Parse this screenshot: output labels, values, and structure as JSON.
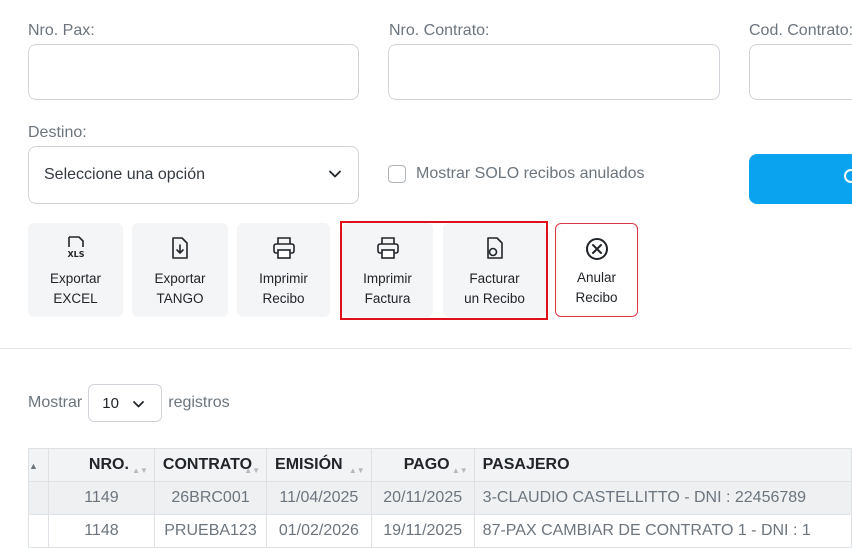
{
  "filters": {
    "nro_pax_label": "Nro. Pax:",
    "nro_contrato_label": "Nro. Contrato:",
    "cod_contrato_label": "Cod. Contrato:",
    "destino_label": "Destino:",
    "destino_value": "Seleccione una opción",
    "solo_anulados_label": "Mostrar SOLO recibos anulados"
  },
  "toolbar": [
    {
      "label_1": "Exportar",
      "label_2": "EXCEL",
      "icon": "xls-icon"
    },
    {
      "label_1": "Exportar",
      "label_2": "TANGO",
      "icon": "file-download-icon"
    },
    {
      "label_1": "Imprimir",
      "label_2": "Recibo",
      "icon": "printer-icon"
    },
    {
      "label_1": "Imprimir",
      "label_2": "Factura",
      "icon": "printer-icon"
    },
    {
      "label_1": "Facturar",
      "label_2": "un Recibo",
      "icon": "file-invoice-icon"
    },
    {
      "label_1": "Anular",
      "label_2": "Recibo",
      "icon": "x-circle-icon"
    }
  ],
  "length": {
    "prefix": "Mostrar",
    "value": "10",
    "suffix": "registros"
  },
  "table": {
    "headers": [
      "",
      "NRO.",
      "CONTRATO",
      "EMISIÓN",
      "PAGO",
      "PASAJERO"
    ],
    "rows": [
      {
        "nro": "1149",
        "contrato": "26BRC001",
        "emision": "11/04/2025",
        "pago": "20/11/2025",
        "pasajero": "3-CLAUDIO CASTELLITTO - DNI : 22456789"
      },
      {
        "nro": "1148",
        "contrato": "PRUEBA123",
        "emision": "01/02/2026",
        "pago": "19/11/2025",
        "pasajero": "87-PAX CAMBIAR DE CONTRATO 1 - DNI : 1"
      }
    ]
  },
  "colors": {
    "accent": "#0aa3f0",
    "danger": "#dc3545",
    "highlight": "#e0101a"
  }
}
